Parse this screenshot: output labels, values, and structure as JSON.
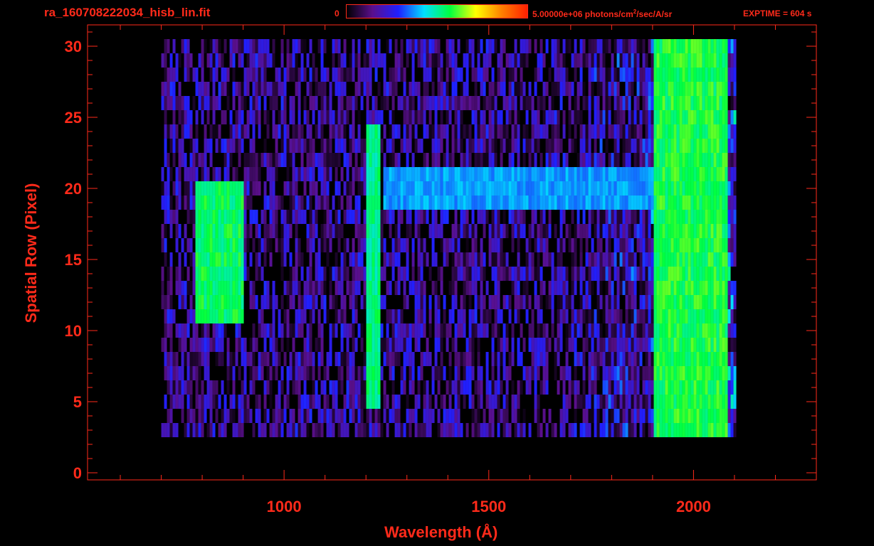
{
  "header": {
    "filename": "ra_160708222034_hisb_lin.fit",
    "colorbar_min": "0",
    "colorbar_max_prefix": "5.00000e+06 photons/cm",
    "colorbar_max_exp": "2",
    "colorbar_max_suffix": "/sec/A/sr",
    "exptime": "EXPTIME = 604 s"
  },
  "colors": {
    "axis": "#ff2a1a",
    "background": "#000000",
    "colormap": [
      "#000000",
      "#5a0f8c",
      "#1f1fff",
      "#00e0ff",
      "#00ff40",
      "#ffff00",
      "#ff8000",
      "#ff2000"
    ]
  },
  "chart_data": {
    "type": "heatmap",
    "title": "",
    "xlabel": "Wavelength (Å)",
    "ylabel": "Spatial Row (Pixel)",
    "xlim": [
      520,
      2300
    ],
    "ylim": [
      -0.5,
      31.5
    ],
    "x_ticks": [
      1000,
      1500,
      2000
    ],
    "y_ticks": [
      0,
      5,
      10,
      15,
      20,
      25,
      30
    ],
    "value_range": [
      0,
      5000000
    ],
    "value_unit": "photons/cm^2/sec/A/sr",
    "data_extent": {
      "x": [
        700,
        2100
      ],
      "rows": [
        3,
        30
      ]
    },
    "features": [
      {
        "name": "vertical-emission-band",
        "x": [
          1195,
          1235
        ],
        "rows": [
          5,
          24
        ],
        "level": 0.55
      },
      {
        "name": "curved-emission-feature",
        "x": [
          780,
          900
        ],
        "rows": [
          11,
          20
        ],
        "level": 0.58
      },
      {
        "name": "horizontal-band",
        "x": [
          1240,
          1970
        ],
        "rows": [
          19,
          21
        ],
        "level": 0.4
      },
      {
        "name": "red-edge",
        "x": [
          1900,
          2080
        ],
        "rows": [
          2,
          30
        ],
        "level": 0.6
      }
    ]
  }
}
